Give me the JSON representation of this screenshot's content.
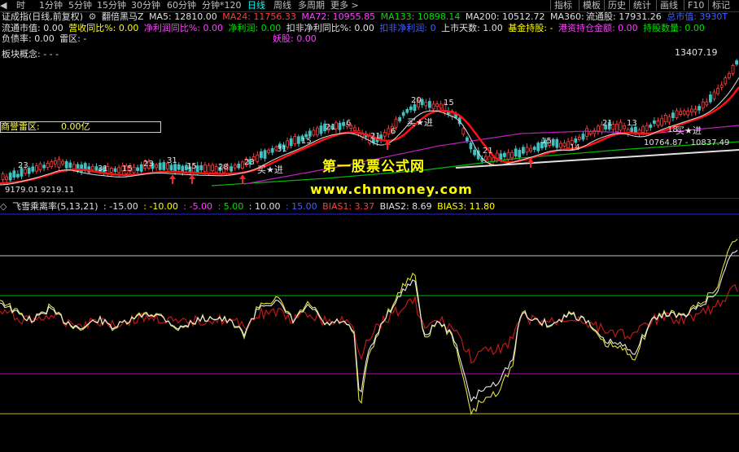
{
  "periods": [
    "1分钟",
    "5分钟",
    "15分钟",
    "30分钟",
    "60分钟",
    "分钟*120",
    "日线",
    "周线",
    "多周期",
    "更多 >"
  ],
  "period_first": "时",
  "toolbar_right": [
    "指标",
    "模板",
    "历史",
    "统计",
    "画线",
    "F10",
    "标记"
  ],
  "info_row1": {
    "name": "证成指(日线,前复权)",
    "indicator": "翻倍黑马Z",
    "ma5": "MA5: 12810.00",
    "ma24": "MA24: 11756.33",
    "ma72": "MA72: 10955.85",
    "ma133": "MA133: 10898.14",
    "ma200": "MA200: 10512.72",
    "ma360": "MA360: -",
    "float_shares": "流通股: 17931.26",
    "total_mv": "总市值: 3930T"
  },
  "info_row2": {
    "float_mv": "流通市值: 0.00",
    "rev_growth": "营收同比%: 0.00",
    "np_growth": "净利润同比%: 0.00",
    "net_profit": "净利润: 0.00",
    "deduct_growth": "扣非净利同比%: 0.00",
    "deduct_np": "扣非净利润: 0",
    "list_days": "上市天数: 1.00",
    "fund_hold": "基金持股: -",
    "hk_hold": "港资持仓金额: 0.00",
    "hold_qty": "持股数量: 0.00"
  },
  "info_row3": {
    "debt_ratio": "负债率: 0.00",
    "leiqu": "雷区: -",
    "yaobao": "妖股: 0.00"
  },
  "sector": "板块概念:    - - -",
  "leiqu_box": {
    "label": "商誉雷区:",
    "value": "0.00亿"
  },
  "price_labels": {
    "high": "13407.19",
    "mid": "10764.87 - 10837.49",
    "low": "9179.01",
    "low2": "9219.11"
  },
  "chart_marks": {
    "buy": "买★进",
    "nums": [
      "23",
      "31",
      "15",
      "23",
      "31",
      "15",
      "28",
      "23",
      "31",
      "15",
      "21",
      "6",
      "21",
      "6",
      "20",
      "15",
      "21",
      "15",
      "14",
      "21",
      "13",
      "18"
    ]
  },
  "watermark": {
    "line1": "第一股票公式网",
    "line2": "www.chnmoney.com"
  },
  "lower_info": {
    "name": "飞雪乘离率(5,13,21)",
    "v1": ": -15.00",
    "v2": ": -10.00",
    "v3": ": -5.00",
    "v4": ": 5.00",
    "v5": ": 10.00",
    "v6": ": 15.00",
    "bias1": "BIAS1: 3.37",
    "bias2": "BIAS2: 8.69",
    "bias3": "BIAS3: 11.80"
  },
  "colors": {
    "red": "#ff3c3c",
    "yellow": "#ffff00",
    "magenta": "#ff40ff",
    "green": "#00e000",
    "white": "#e0e0e0",
    "blue": "#2020ff"
  }
}
